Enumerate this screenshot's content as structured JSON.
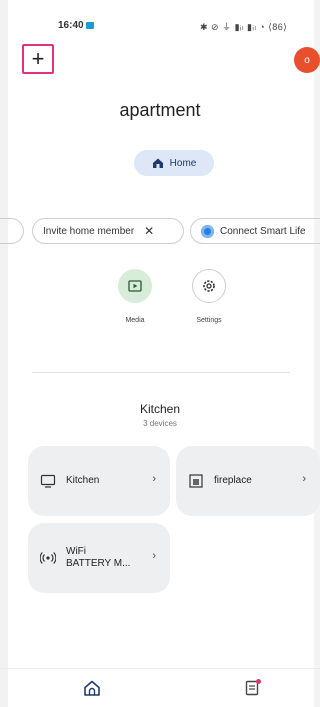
{
  "status_bar": {
    "time": "16:40",
    "icons": "✱ ⊘ ⏚ ▮ᵢₗ ▮ᵢₗ ◔ ⟨86⟩"
  },
  "top_bar": {
    "add_icon": "+",
    "avatar_initial": "o"
  },
  "home": {
    "title": "apartment",
    "chip_label": "Home"
  },
  "suggestions": [
    {
      "label": "Invite home member",
      "close": "✕"
    },
    {
      "label": "Connect Smart Life"
    }
  ],
  "actions": [
    {
      "label": "Media",
      "icon": "media-icon"
    },
    {
      "label": "Settings",
      "icon": "gear-icon"
    }
  ],
  "room": {
    "name": "Kitchen",
    "device_count": "3 devices"
  },
  "devices": [
    {
      "name": "Kitchen",
      "icon": "display-icon",
      "chevron": "›"
    },
    {
      "name": "fireplace",
      "icon": "frame-icon",
      "chevron": "›"
    },
    {
      "name_line1": "WiFi",
      "name_line2": "BATTERY M...",
      "icon": "wifi-icon",
      "chevron": "›"
    }
  ],
  "bottom_nav": [
    {
      "icon": "home-icon"
    },
    {
      "icon": "activity-icon"
    }
  ],
  "colors": {
    "accent": "#e0337b",
    "avatar": "#e8502d",
    "home_chip": "#dde7f7",
    "media_circle": "#d7ecd9",
    "tile_bg": "#eeeff1"
  }
}
